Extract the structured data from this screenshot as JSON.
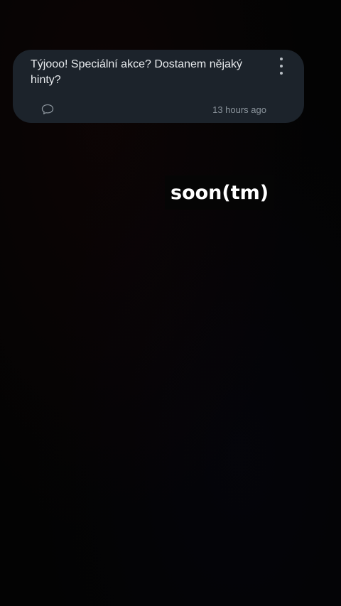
{
  "comment": {
    "text": "Týjooo! Speciální akce? Dostanem nějaký hinty?",
    "timestamp": "13 hours ago",
    "reply_icon": "speech-bubble-icon",
    "menu_icon": "more-vertical-icon"
  },
  "overlay": {
    "text": "soon(tm)"
  },
  "colors": {
    "card_background": "#1c232b",
    "page_background": "#030303",
    "comment_text": "#e9ecef",
    "timestamp_text": "#8b949c"
  }
}
